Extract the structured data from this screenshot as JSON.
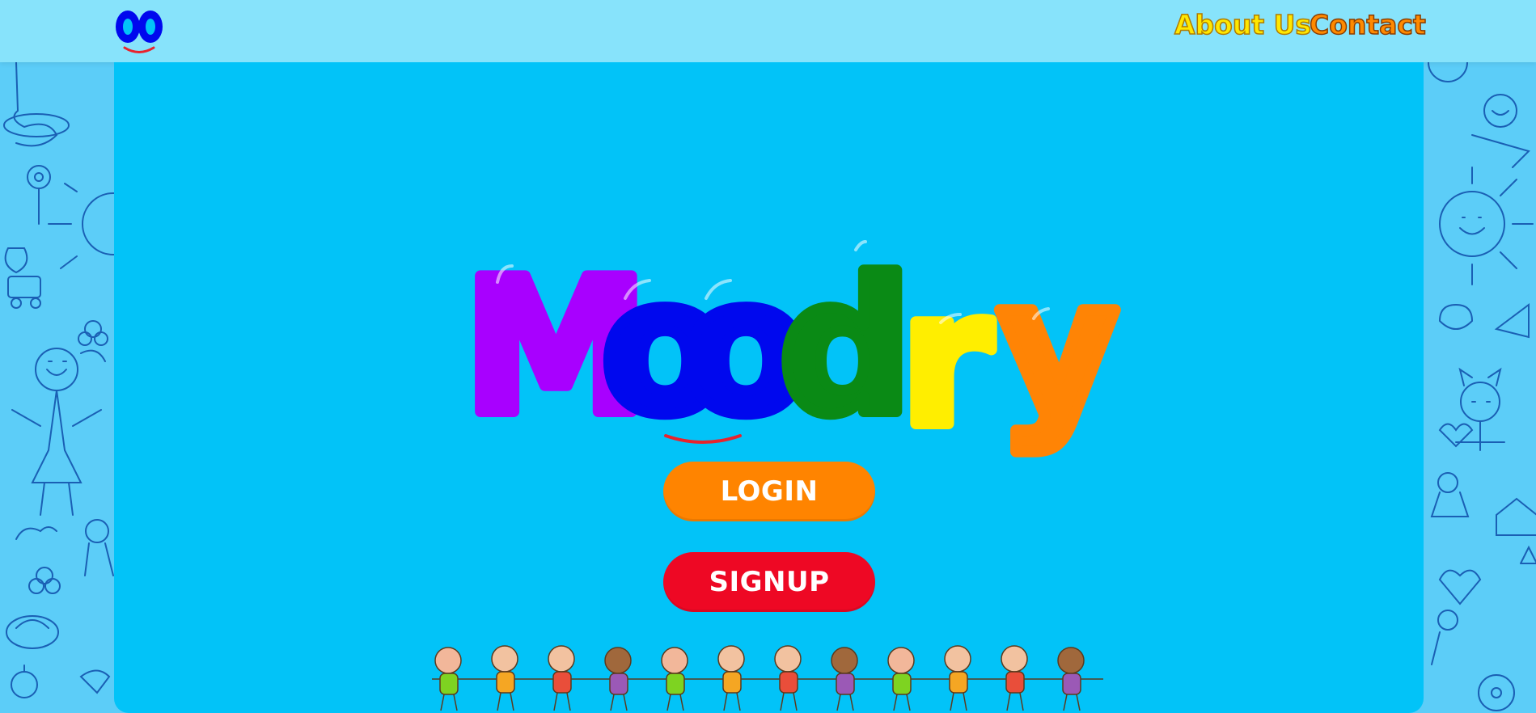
{
  "header": {
    "logo_alt": "oo",
    "nav": [
      {
        "label": "About Us",
        "color": "#ffe800"
      },
      {
        "label": "Contact",
        "color": "#ff8a00"
      }
    ]
  },
  "hero": {
    "title": "Moodry",
    "letters": [
      {
        "char": "M",
        "color": "#a800ff"
      },
      {
        "char": "o",
        "color": "#0008ee"
      },
      {
        "char": "o",
        "color": "#0008ee"
      },
      {
        "char": "d",
        "color": "#0a8a15"
      },
      {
        "char": "r",
        "color": "#ffee00"
      },
      {
        "char": "y",
        "color": "#ff8405"
      }
    ],
    "smile_color": "#e8232d"
  },
  "actions": {
    "login_label": "LOGIN",
    "signup_label": "SIGNUP"
  },
  "colors": {
    "page_bg": "#5ccdf8",
    "header_bg": "#87e3fb",
    "panel_bg": "#02c3f8",
    "login_bg": "#ff8400",
    "signup_bg": "#ee0824",
    "doodle_stroke": "#1a5fb4"
  },
  "icons": [
    "logo-icon",
    "doodle-pattern-icon",
    "kids-holding-hands-illustration"
  ]
}
